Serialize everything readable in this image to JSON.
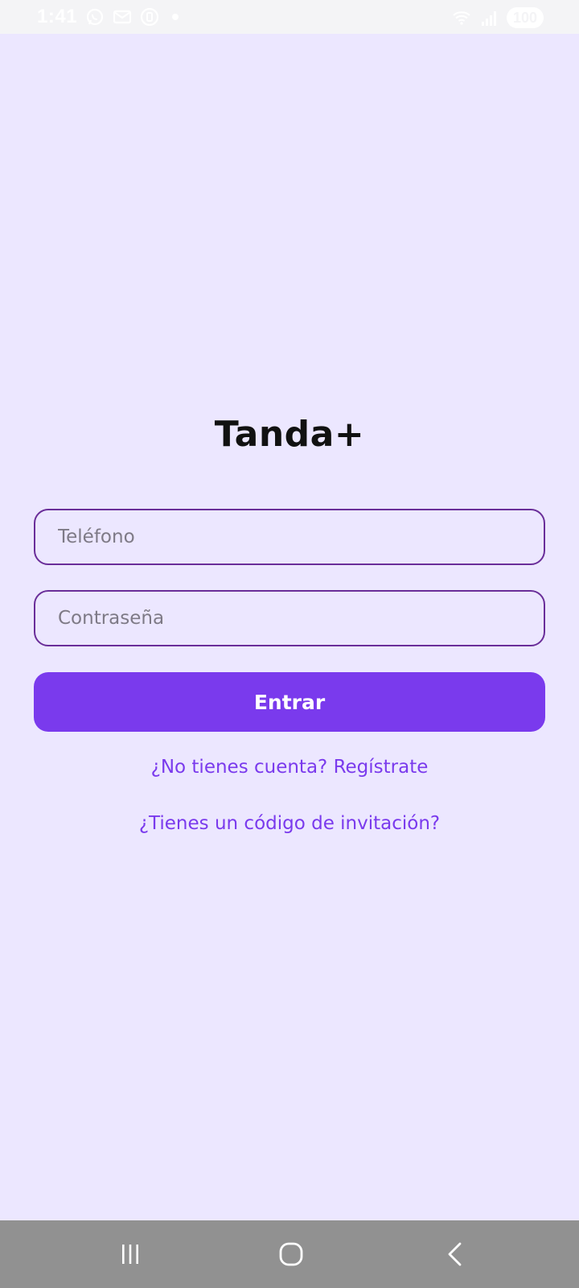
{
  "status_bar": {
    "time": "1:41",
    "battery": "100",
    "icons": [
      "whatsapp-icon",
      "mail-icon",
      "notification-icon",
      "wifi-icon",
      "signal-icon",
      "battery-icon"
    ]
  },
  "app": {
    "title": "Tanda+"
  },
  "login_form": {
    "phone_placeholder": "Teléfono",
    "password_placeholder": "Contraseña",
    "submit_label": "Entrar"
  },
  "links": {
    "register": "¿No tienes cuenta? Regístrate",
    "invite_code": "¿Tienes un código de invitación?"
  },
  "nav_bar": {
    "icons": [
      "recent-apps-icon",
      "home-icon",
      "back-icon"
    ]
  },
  "colors": {
    "background": "#ECE7FF",
    "accent": "#7A3AED",
    "field_border": "#6A2E99",
    "title": "#111111",
    "nav_bar": "#919191"
  }
}
